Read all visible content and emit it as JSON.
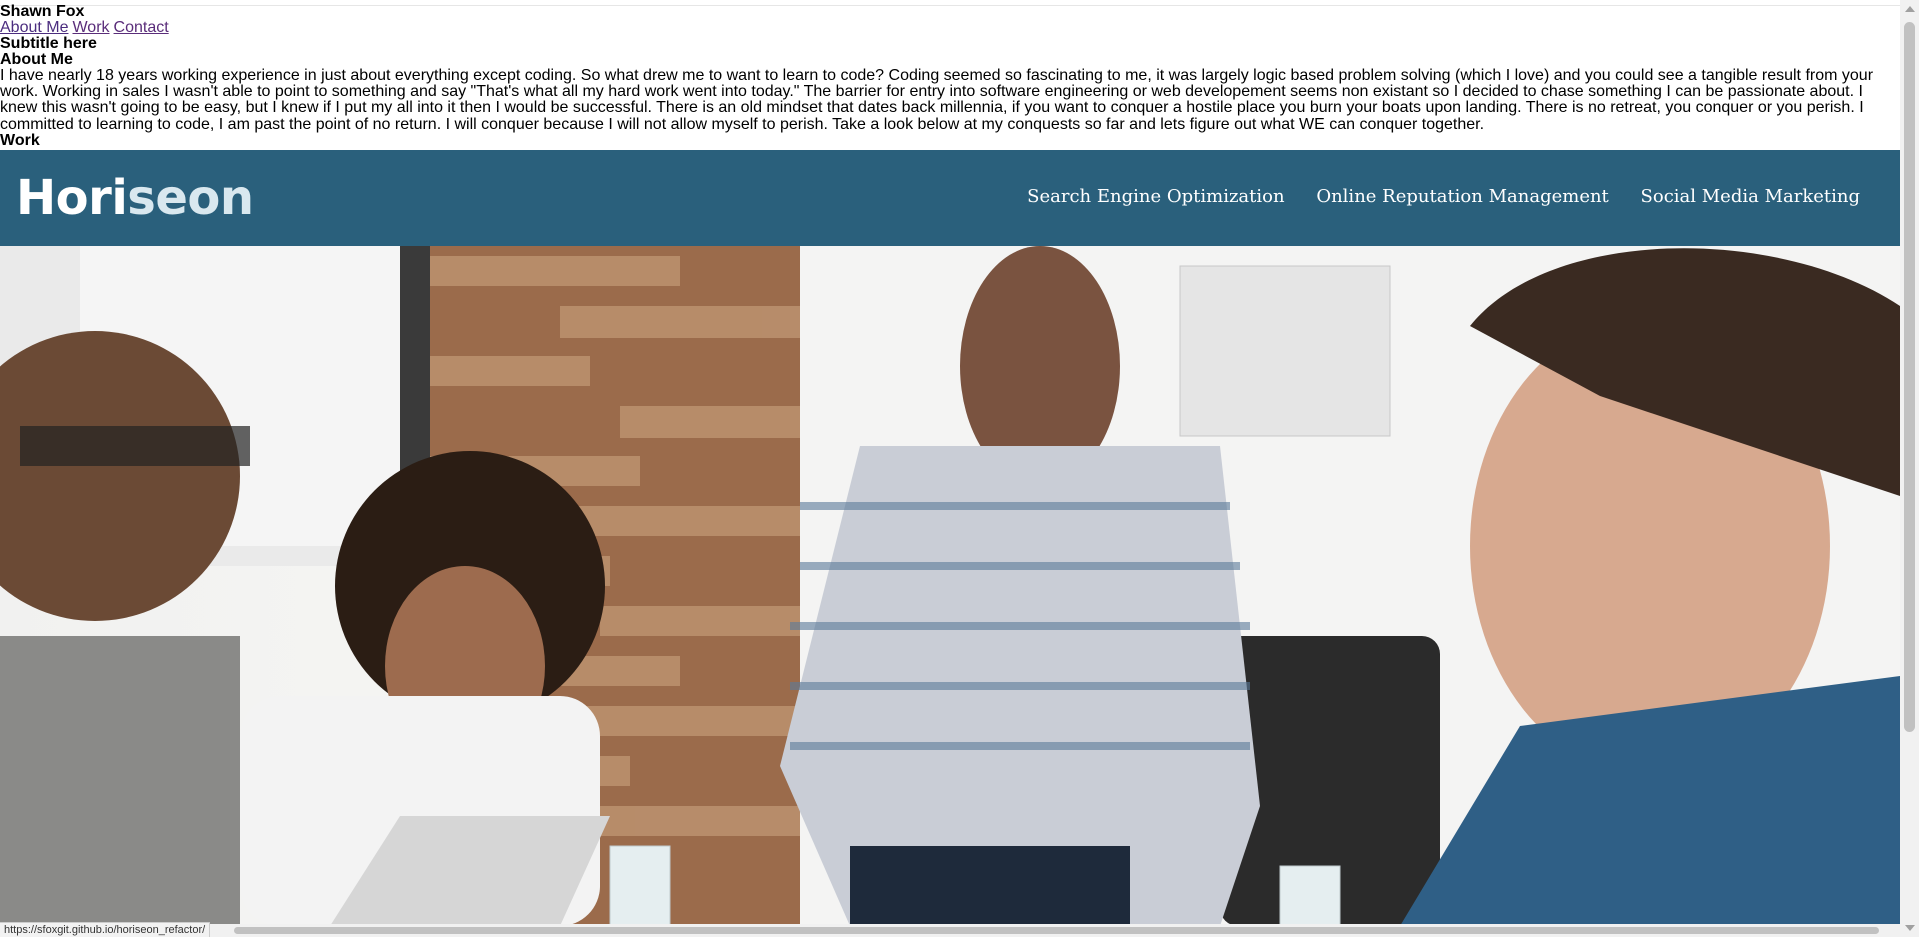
{
  "raw_header": {
    "name": "Shawn Fox",
    "nav": [
      "About Me",
      "Work",
      "Contact"
    ],
    "subtitle": "Subtitle here",
    "about_heading": "About Me",
    "about_text": "I have nearly 18 years working experience in just about everything except coding. So what drew me to want to learn to code? Coding seemed so fascinating to me, it was largely logic based problem solving (which I love) and you could see a tangible result from your work. Working in sales I wasn't able to point to something and say \"That's what all my hard work went into today.\" The barrier for entry into software engineering or web developement seems non existant so I decided to chase something I can be passionate about. I knew this wasn't going to be easy, but I knew if I put my all into it then I would be successful. There is an old mindset that dates back millennia, if you want to conquer a hostile place you burn your boats upon landing. There is no retreat, you conquer or you perish. I committed to learning to code, I am past the point of no return. I will conquer because I will not allow myself to perish. Take a look below at my conquests so far and lets figure out what WE can conquer together.",
    "work_heading": "Work"
  },
  "site": {
    "logo_part1": "Hori",
    "logo_part2": "seon",
    "nav": [
      "Search Engine Optimization",
      "Online Reputation Management",
      "Social Media Marketing"
    ],
    "header_color": "#2a607c"
  },
  "hero": {
    "icon": "team-meeting-photo"
  },
  "status_bar": {
    "url": "https://sfoxgit.github.io/horiseon_refactor/"
  }
}
